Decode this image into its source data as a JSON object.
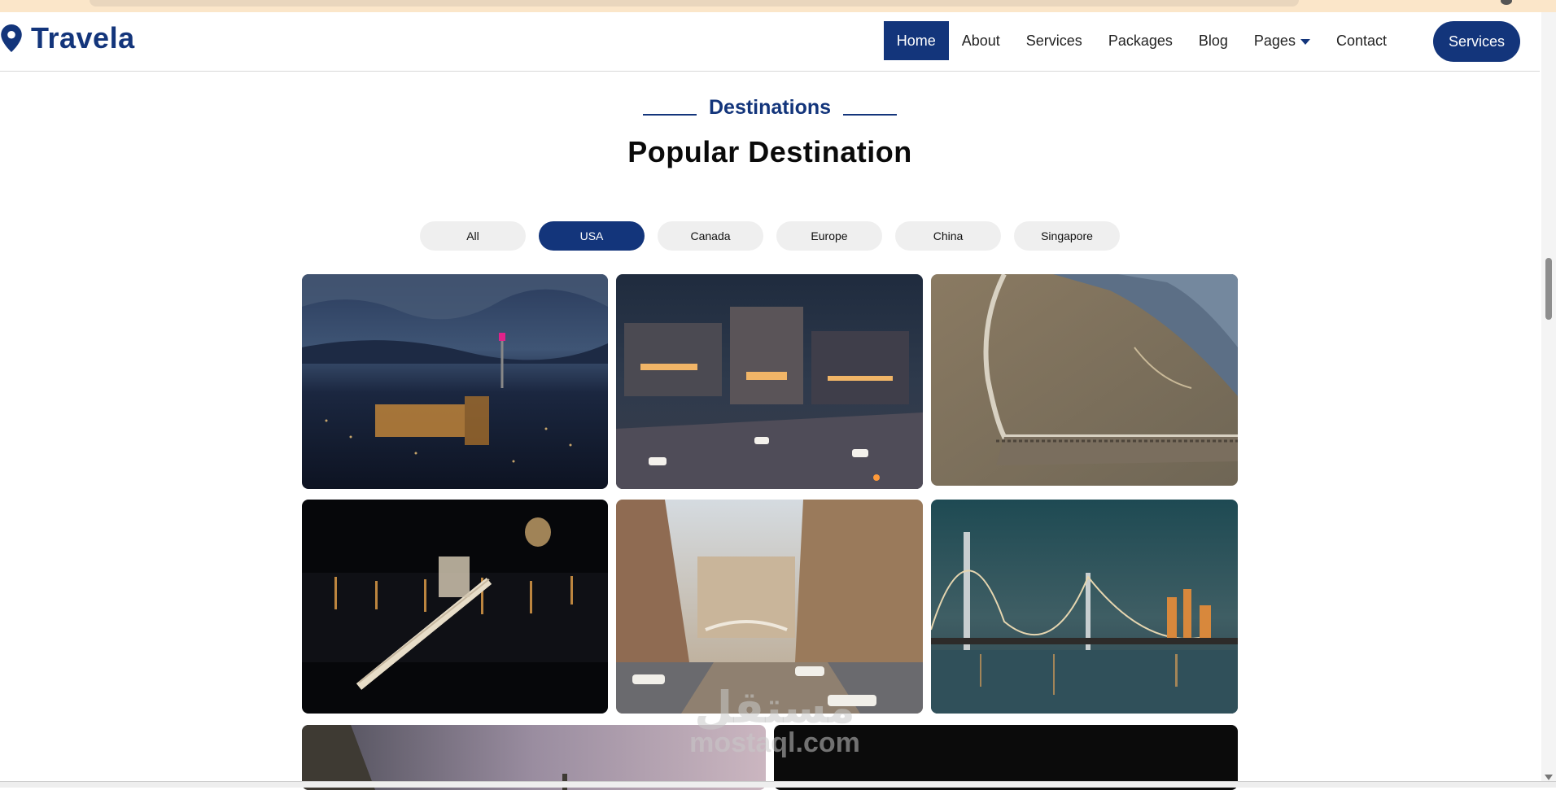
{
  "brand": {
    "name": "Travela"
  },
  "nav": {
    "items": [
      {
        "label": "Home",
        "active": true
      },
      {
        "label": "About"
      },
      {
        "label": "Services"
      },
      {
        "label": "Packages"
      },
      {
        "label": "Blog"
      },
      {
        "label": "Pages"
      },
      {
        "label": "Contact"
      }
    ],
    "cta_label": "Services"
  },
  "section": {
    "subtitle": "Destinations",
    "title": "Popular Destination"
  },
  "filters": [
    "All",
    "USA",
    "Canada",
    "Europe",
    "China",
    "Singapore"
  ],
  "selected_filter": "USA",
  "watermark": {
    "arabic": "مستقل",
    "latin": "mostaql.com"
  },
  "colors": {
    "brand": "#13357b",
    "pill_bg": "#efefef"
  }
}
